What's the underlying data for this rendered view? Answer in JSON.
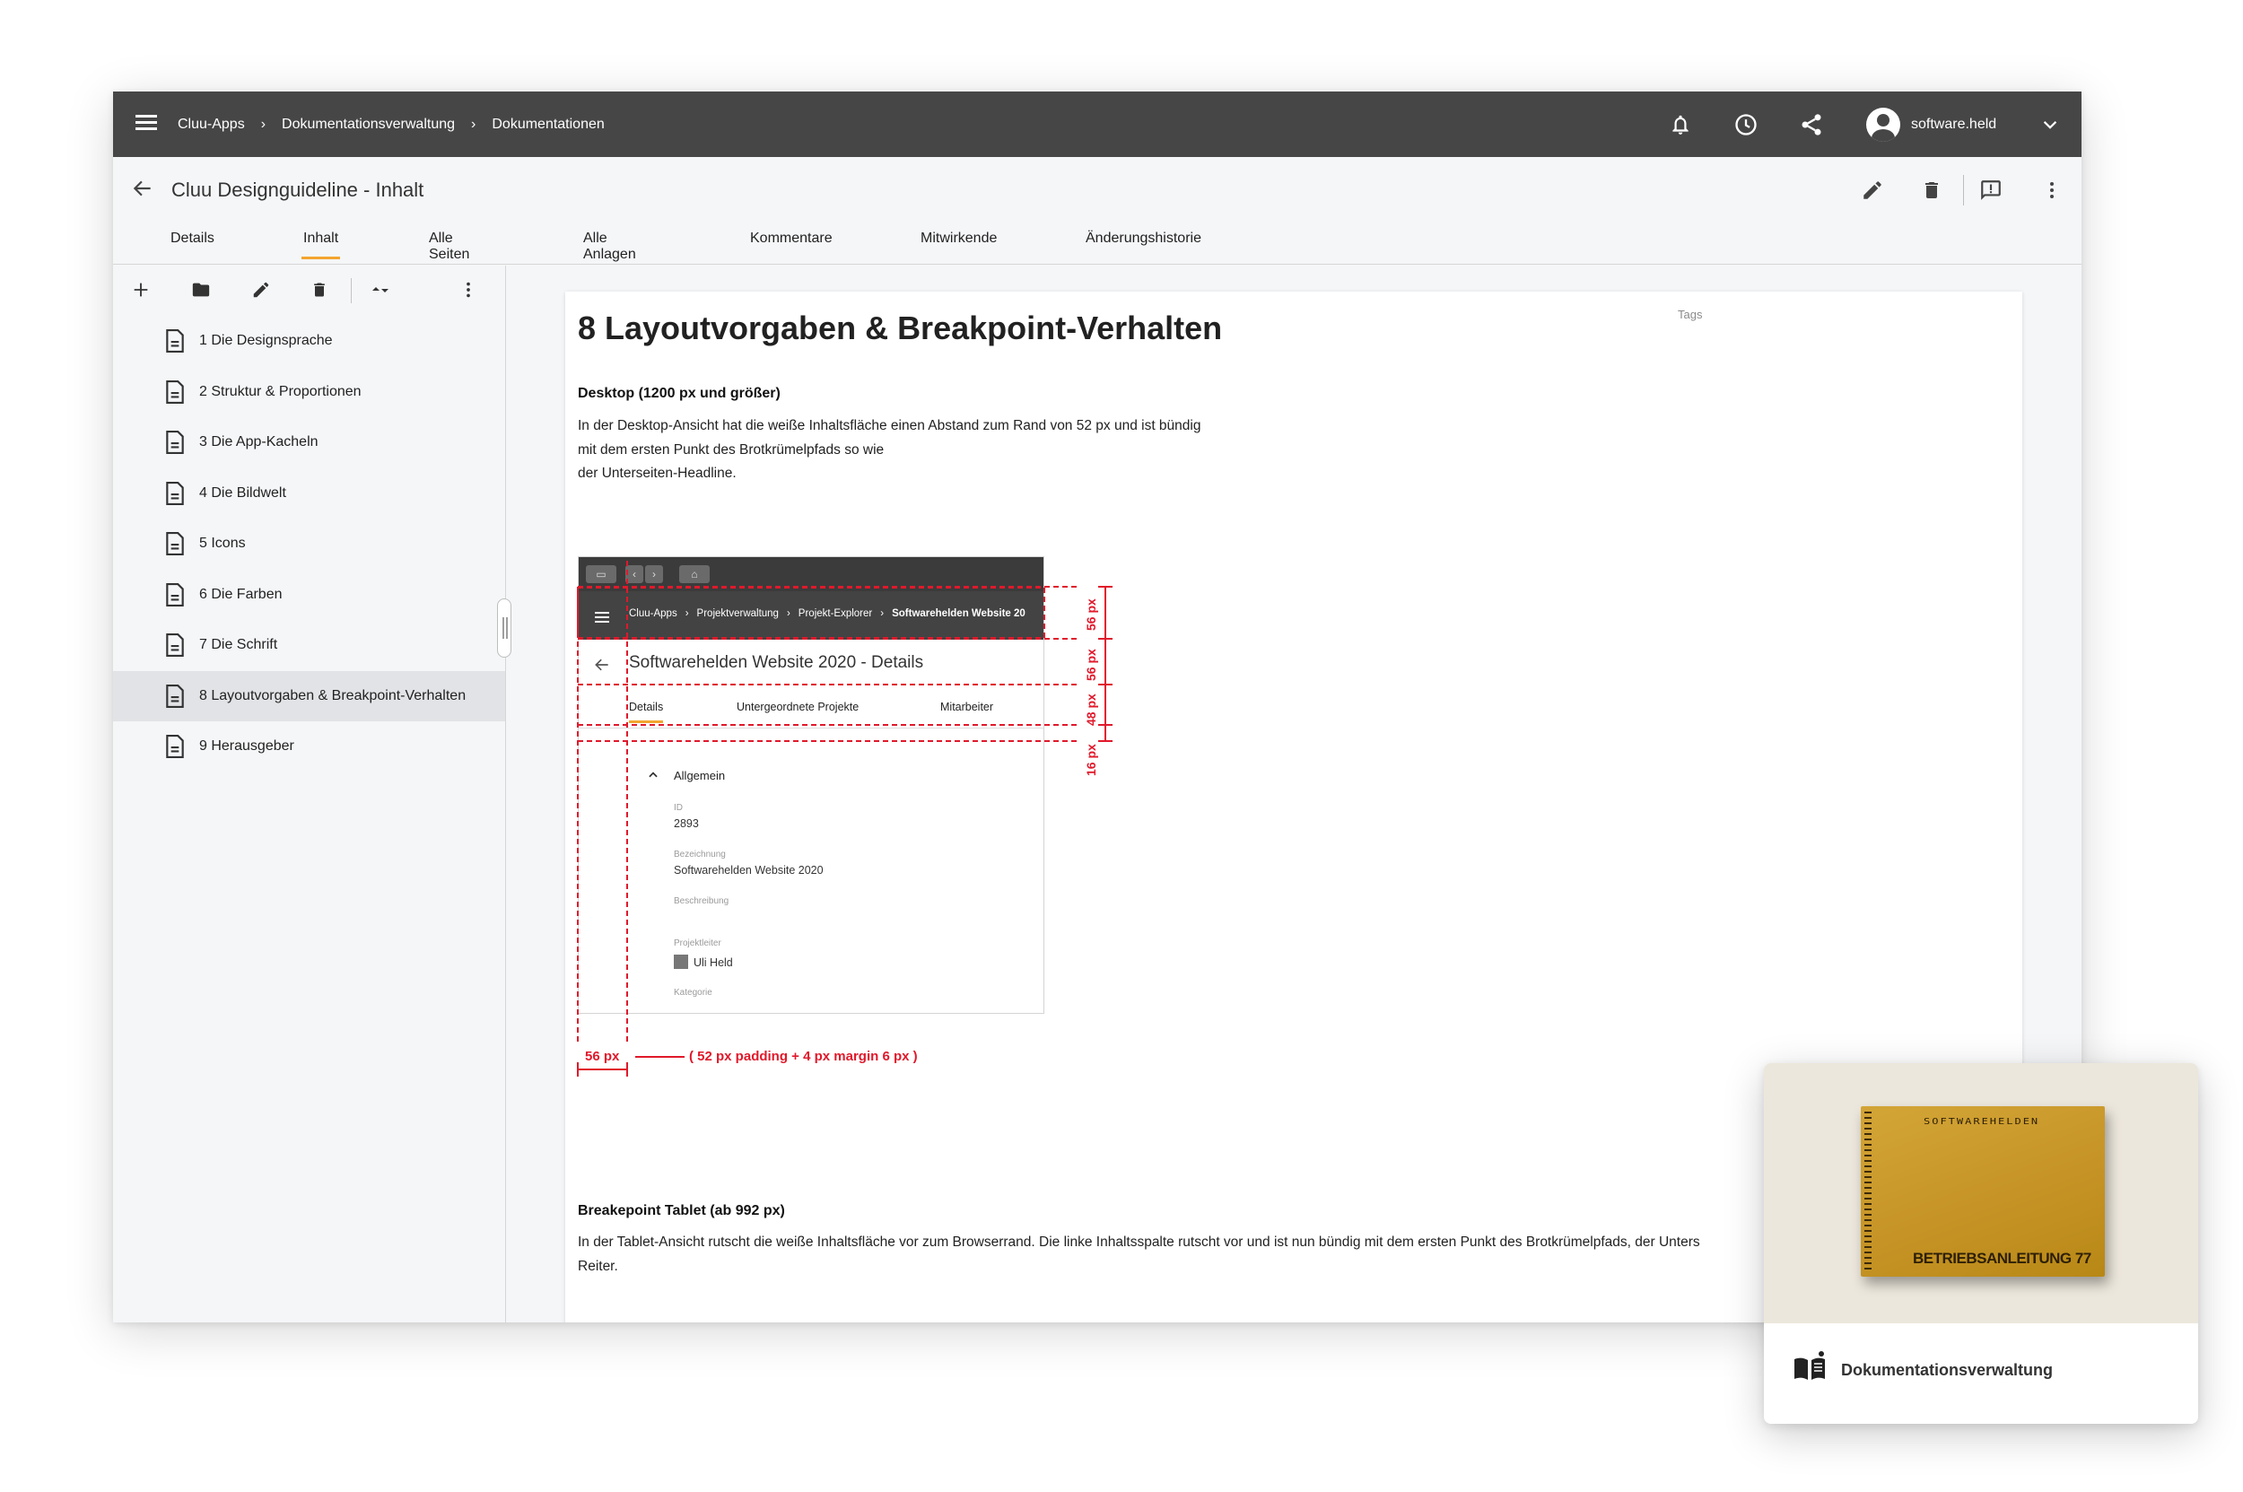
{
  "topbar": {
    "breadcrumb": [
      "Cluu-Apps",
      "Dokumentationsverwaltung",
      "Dokumentationen"
    ],
    "user_name": "software.held",
    "icons": [
      "menu-icon",
      "bell-icon",
      "clock-icon",
      "share-icon",
      "account-icon",
      "chevron-down-icon"
    ]
  },
  "doc": {
    "title": "Cluu Designguideline - Inhalt",
    "tabs": [
      "Details",
      "Inhalt",
      "Alle Seiten",
      "Alle Anlagen",
      "Kommentare",
      "Mitwirkende",
      "Änderungshistorie"
    ],
    "active_tab": "Inhalt"
  },
  "sidebar": {
    "pages": [
      "1 Die Designsprache",
      "2 Struktur & Proportionen",
      "3 Die App-Kacheln",
      "4 Die Bildwelt",
      "5 Icons",
      "6 Die Farben",
      "7 Die Schrift",
      "8 Layoutvorgaben & Breakpoint-Verhalten",
      "9 Herausgeber"
    ],
    "active_index": 7
  },
  "content": {
    "tags_label": "Tags",
    "heading": "8 Layoutvorgaben & Breakpoint-Verhalten",
    "section1_title": "Desktop (1200 px und größer)",
    "section1_lines": [
      "In der Desktop-Ansicht hat die weiße Inhaltsfläche einen Abstand zum Rand von 52 px und ist bündig",
      "mit dem ersten Punkt des Brotkrümelpfads so wie",
      "der Unterseiten-Headline."
    ],
    "section2_title": "Breakepoint Tablet (ab 992 px)",
    "section2_lines": [
      "In der Tablet-Ansicht rutscht die weiße Inhaltsfläche vor zum Browserrand. Die linke Inhaltsspalte rutscht vor und ist nun bündig mit dem ersten Punkt des Brotkrümelpfads, der Unters",
      "Reiter."
    ]
  },
  "embedded_screenshot": {
    "breadcrumb": [
      "Cluu-Apps",
      "Projektverwaltung",
      "Projekt-Explorer",
      "Softwarehelden Website 20"
    ],
    "title": "Softwarehelden Website 2020 - Details",
    "tabs": [
      "Details",
      "Untergeordnete Projekte",
      "Mitarbeiter"
    ],
    "section": "Allgemein",
    "fields": [
      {
        "label": "ID",
        "value": "2893"
      },
      {
        "label": "Bezeichnung",
        "value": "Softwarehelden Website 2020"
      },
      {
        "label": "Beschreibung",
        "value": ""
      },
      {
        "label": "Projektleiter",
        "value": "Uli Held"
      },
      {
        "label": "Kategorie",
        "value": ""
      }
    ]
  },
  "dimensions": {
    "v_labels": [
      "56 px",
      "56 px",
      "48 px",
      "16 px"
    ],
    "left_label": "56 px",
    "left_note": "( 52 px padding + 4 px margin 6 px )",
    "color": "#e0192b"
  },
  "card": {
    "label": "Dokumentationsverwaltung",
    "book_top": "SOFTWAREHELDEN",
    "book_title": "BETRIEBSANLEITUNG 77",
    "icon": "book-icon"
  },
  "colors": {
    "topbar": "#464646",
    "accent": "#f2a530",
    "background": "#f5f6f8"
  }
}
